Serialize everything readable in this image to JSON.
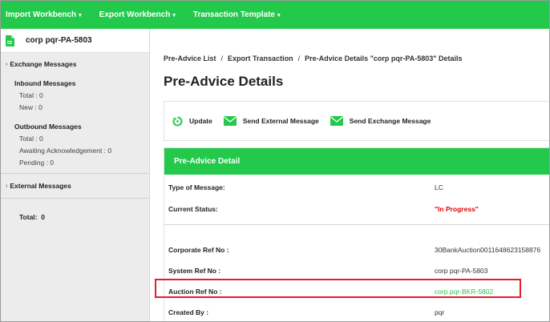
{
  "topnav": [
    {
      "label": "Import Workbench"
    },
    {
      "label": "Export Workbench"
    },
    {
      "label": "Transaction Template"
    }
  ],
  "sidebar": {
    "corp_name": "corp pqr-PA-5803",
    "exchange_title": "Exchange Messages",
    "inbound_title": "Inbound Messages",
    "inbound_total": "Total : 0",
    "inbound_new": "New : 0",
    "outbound_title": "Outbound Messages",
    "outbound_total": "Total : 0",
    "outbound_awaiting": "Awaiting Acknowledgement : 0",
    "outbound_pending": "Pending : 0",
    "external_title": "External Messages",
    "total_label": "Total:",
    "total_value": "0"
  },
  "breadcrumb": [
    "Pre-Advice List",
    "Export Transaction",
    "Pre-Advice Details \"corp pqr-PA-5803\" Details"
  ],
  "page_title": "Pre-Advice Details",
  "toolbar": {
    "update": "Update",
    "send_external": "Send External Message",
    "send_exchange": "Send Exchange Message"
  },
  "panel": {
    "title": "Pre-Advice Detail",
    "type_label": "Type of Message:",
    "type_value": "LC",
    "status_label": "Current Status:",
    "status_value": "\"In Progress\"",
    "corp_ref_label": "Corporate Ref No :",
    "corp_ref_value": "30BankAuction0011648623158876",
    "system_ref_label": "System Ref No :",
    "system_ref_value": "corp pqr-PA-5803",
    "auction_ref_label": "Auction Ref No :",
    "auction_ref_value": "corp pqr-BKR-5802",
    "created_by_label": "Created By :",
    "created_by_value": "pqr"
  },
  "colors": {
    "accent": "#22c94b",
    "status": "#e00000",
    "highlight": "#e41e2b"
  }
}
